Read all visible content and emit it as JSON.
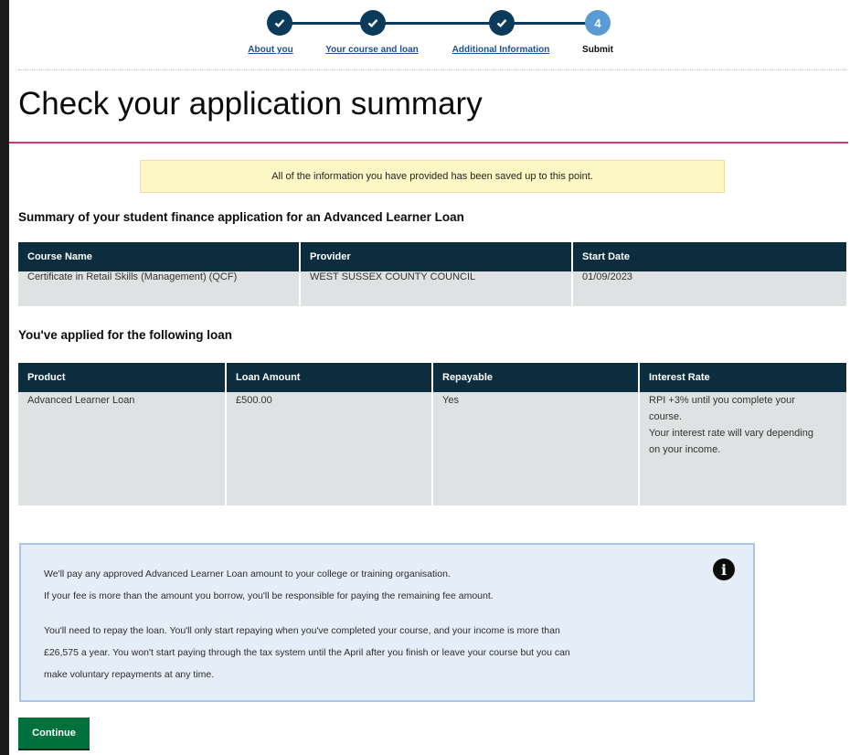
{
  "stepper": {
    "steps": [
      {
        "number": "1",
        "label": "About you",
        "status": "complete"
      },
      {
        "number": "2",
        "label": "Your course and loan",
        "status": "complete"
      },
      {
        "number": "3",
        "label": "Additional Information",
        "status": "complete"
      },
      {
        "number": "4",
        "label": "Submit",
        "status": "current"
      }
    ]
  },
  "page": {
    "title": "Check your application summary",
    "saved_notice": "All of the information you have provided has been saved up to this point.",
    "summary_heading": "Summary of your student finance application for an Advanced Learner Loan",
    "loan_heading": "You've applied for the following loan"
  },
  "course_table": {
    "headers": [
      "Course Name",
      "Provider",
      "Start Date"
    ],
    "row": [
      "Certificate in Retail Skills (Management) (QCF)",
      "WEST SUSSEX COUNTY COUNCIL",
      "01/09/2023"
    ]
  },
  "loan_table": {
    "headers": [
      "Product",
      "Loan Amount",
      "Repayable",
      "Interest Rate"
    ],
    "row": {
      "product": "Advanced Learner Loan",
      "amount": "£500.00",
      "repayable": "Yes",
      "interest_line1": "RPI +3% until you complete your",
      "interest_line2": "course.",
      "interest_line3": "Your interest rate will vary depending",
      "interest_line4": "on your income."
    }
  },
  "info": {
    "icon": "info-icon",
    "line1": "We'll pay any approved Advanced Learner Loan amount to your college or training organisation.",
    "line2": "If your fee is more than the amount you borrow, you'll be responsible for paying the remaining fee amount.",
    "line3": "You'll need to repay the loan. You'll only start repaying when you've completed your course, and your income is more than",
    "line4": "£26,575 a year. You won't start paying through the tax system until the April after you finish or leave your course but you can",
    "line5": "make voluntary repayments at any time."
  },
  "actions": {
    "continue_label": "Continue"
  },
  "colors": {
    "header_cell": "#0c2d3d",
    "step_complete": "#0b3b5a",
    "step_current": "#5b9bd5",
    "title_rule": "#d4367a",
    "continue_button": "#00703c"
  }
}
